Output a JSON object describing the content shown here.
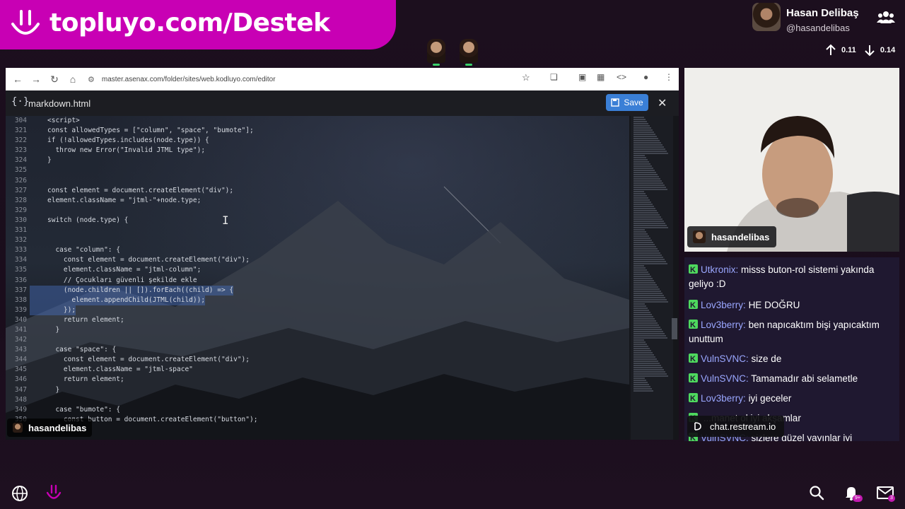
{
  "banner": {
    "text": "topluyo.com/Destek",
    "icon": "smile-logo-icon"
  },
  "profile": {
    "name": "Hasan Delibaş",
    "handle": "@hasandelibas",
    "icon": "users-icon"
  },
  "stats": {
    "up": "0.11",
    "down": "0.14"
  },
  "browser": {
    "url": "master.asenax.com/folder/sites/web.kodluyo.com/editor",
    "file_name": "markdown.html",
    "save_label": "Save"
  },
  "code_lines": [
    {
      "n": "304",
      "t": "<script>",
      "sel": false
    },
    {
      "n": "321",
      "t": "const allowedTypes = [\"column\", \"space\", \"bumote\"];",
      "sel": false
    },
    {
      "n": "322",
      "t": "if (!allowedTypes.includes(node.type)) {",
      "sel": false
    },
    {
      "n": "323",
      "t": "  throw new Error(\"Invalid JTML type\");",
      "sel": false
    },
    {
      "n": "324",
      "t": "}",
      "sel": false
    },
    {
      "n": "325",
      "t": "",
      "sel": false
    },
    {
      "n": "326",
      "t": "",
      "sel": false
    },
    {
      "n": "327",
      "t": "const element = document.createElement(\"div\");",
      "sel": false
    },
    {
      "n": "328",
      "t": "element.className = \"jtml-\"+node.type;",
      "sel": false
    },
    {
      "n": "329",
      "t": "",
      "sel": false
    },
    {
      "n": "330",
      "t": "switch (node.type) {",
      "sel": false
    },
    {
      "n": "331",
      "t": "",
      "sel": false
    },
    {
      "n": "332",
      "t": "",
      "sel": false
    },
    {
      "n": "333",
      "t": "  case \"column\": {",
      "sel": false
    },
    {
      "n": "334",
      "t": "    const element = document.createElement(\"div\");",
      "sel": false
    },
    {
      "n": "335",
      "t": "    element.className = \"jtml-column\";",
      "sel": false
    },
    {
      "n": "336",
      "t": "    // Çocukları güvenli şekilde ekle",
      "sel": false
    },
    {
      "n": "337",
      "t": "    (node.children || []).forEach((child) => {",
      "sel": true
    },
    {
      "n": "338",
      "t": "      element.appendChild(JTML(child));",
      "sel": true
    },
    {
      "n": "339",
      "t": "    });",
      "sel": true
    },
    {
      "n": "340",
      "t": "    return element;",
      "sel": false
    },
    {
      "n": "341",
      "t": "  }",
      "sel": false
    },
    {
      "n": "342",
      "t": "",
      "sel": false
    },
    {
      "n": "343",
      "t": "  case \"space\": {",
      "sel": false
    },
    {
      "n": "344",
      "t": "    const element = document.createElement(\"div\");",
      "sel": false
    },
    {
      "n": "345",
      "t": "    element.className = \"jtml-space\"",
      "sel": false
    },
    {
      "n": "346",
      "t": "    return element;",
      "sel": false
    },
    {
      "n": "347",
      "t": "  }",
      "sel": false
    },
    {
      "n": "348",
      "t": "",
      "sel": false
    },
    {
      "n": "349",
      "t": "  case \"bumote\": {",
      "sel": false
    },
    {
      "n": "350",
      "t": "    const button = document.createElement(\"button\");",
      "sel": false
    }
  ],
  "screen_label": "hasandelibas",
  "webcam_label": "hasandelibas",
  "chat": [
    {
      "user": "Utkronix:",
      "text": "misss buton-rol sistemi yakında geliyo :D"
    },
    {
      "user": "Lov3berry:",
      "text": "HE DOĞRU"
    },
    {
      "user": "Lov3berry:",
      "text": "ben napıcaktım bişi yapıcaktım unuttum"
    },
    {
      "user": "VulnSVNC:",
      "text": "size de"
    },
    {
      "user": "VulnSVNC:",
      "text": "Tamamadır abi selametle"
    },
    {
      "user": "Lov3berry:",
      "text": "iyi geceler"
    },
    {
      "user": "",
      "text": "...manet ol iyi akşamlar"
    },
    {
      "user": "VulnSVNC:",
      "text": "sizlere güzel yayınlar iyi"
    }
  ],
  "chat_footer": "chat.restream.io",
  "bottom": {
    "notif_badge": "9+",
    "mail_badge": "3"
  }
}
